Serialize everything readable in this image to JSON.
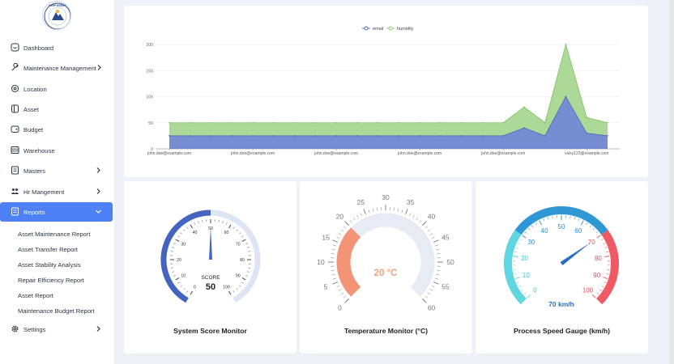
{
  "sidebar": {
    "items": [
      {
        "label": "Dashboard",
        "icon": "dashboard-icon"
      },
      {
        "label": "Maintenance Management",
        "icon": "wrench-icon",
        "has_children": true
      },
      {
        "label": "Location",
        "icon": "location-icon"
      },
      {
        "label": "Asset",
        "icon": "asset-icon"
      },
      {
        "label": "Budget",
        "icon": "wallet-icon"
      },
      {
        "label": "Warehouse",
        "icon": "warehouse-icon"
      },
      {
        "label": "Masters",
        "icon": "masters-icon",
        "has_children": true
      },
      {
        "label": "Hr Mangement",
        "icon": "users-icon",
        "has_children": true
      },
      {
        "label": "Reports",
        "icon": "report-icon",
        "has_children": true,
        "active": true
      }
    ],
    "report_subitems": [
      "Asset Maintenance Report",
      "Asset Transfer Report",
      "Asset Stability Analysis",
      "Repair Efficiency Report",
      "Asset Report",
      "Maintenance Budget Report"
    ],
    "settings": {
      "label": "Settings",
      "icon": "gear-icon"
    },
    "active_color": "#4d81f5"
  },
  "chart_data": {
    "type": "area",
    "stacked": true,
    "title": "",
    "xlabel": "",
    "ylabel": "",
    "ylim": [
      0,
      200
    ],
    "yticks": [
      0,
      50,
      100,
      150,
      200
    ],
    "grid": true,
    "legend_position": "top-center",
    "x_tick_labels": [
      "john.doe@example.com",
      "john.doe@example.com",
      "john.doe@example.com",
      "john.doe@example.com",
      "john.doe@example.com",
      "vicky123@example.com"
    ],
    "series": [
      {
        "name": "email",
        "color": "#5470c6",
        "values": [
          25,
          25,
          25,
          25,
          25,
          25,
          25,
          25,
          25,
          25,
          25,
          25,
          25,
          25,
          25,
          25,
          25,
          40,
          25,
          100,
          30,
          25
        ]
      },
      {
        "name": "humidity",
        "color": "#91cc75",
        "values": [
          25,
          25,
          25,
          25,
          25,
          25,
          25,
          25,
          25,
          25,
          25,
          25,
          25,
          25,
          25,
          25,
          25,
          40,
          25,
          100,
          30,
          25
        ]
      }
    ]
  },
  "gauges": {
    "score": {
      "title": "System Score Monitor",
      "center_label": "SCORE",
      "value": 50,
      "min": 0,
      "max": 100,
      "ticks": [
        "0",
        "10",
        "20",
        "30",
        "40",
        "50",
        "60",
        "70",
        "80",
        "90",
        "100"
      ],
      "color": "#4464bf"
    },
    "temperature": {
      "title": "Temperature Monitor (°C)",
      "value_text": "20 °C",
      "value": 20,
      "min": 0,
      "max": 60,
      "ticks": [
        "0",
        "5",
        "10",
        "15",
        "20",
        "25",
        "30",
        "35",
        "40",
        "45",
        "50",
        "55",
        "60"
      ],
      "color": "#f4855f"
    },
    "speed": {
      "title": "Process Speed Gauge (km/h)",
      "value_text": "70 km/h",
      "value": 70,
      "min": 0,
      "max": 100,
      "ticks": [
        "0",
        "10",
        "20",
        "30",
        "40",
        "50",
        "60",
        "70",
        "80",
        "90",
        "100"
      ],
      "colors": [
        "#5fd6e0",
        "#2f97d6",
        "#f05a64"
      ]
    }
  }
}
